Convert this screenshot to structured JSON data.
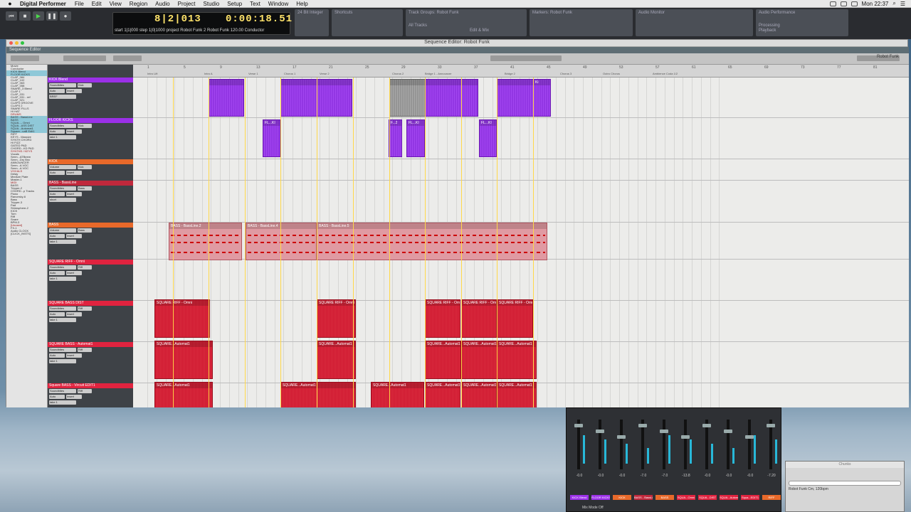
{
  "menubar": {
    "app": "Digital Performer",
    "items": [
      "File",
      "Edit",
      "View",
      "Region",
      "Audio",
      "Project",
      "Studio",
      "Setup",
      "Text",
      "Window",
      "Help"
    ],
    "clock": "Mon 22:37"
  },
  "toolbar": {
    "counter_bars": "8|2|013",
    "counter_time": "0:00:18.51",
    "counter_line": "start 1|1|000 step 1|0|1000 project Robot Funk 2 Robot Funk 120.00 Conductor",
    "panels": [
      "Shortcuts",
      "Track Groups: Robot Funk",
      "Markers: Robot Funk",
      "Audio Monitor",
      "Audio Performance"
    ],
    "panel_sub": [
      "All Tracks",
      "Edit & Mix",
      "Processing",
      "Playback",
      "24 Bit Integer"
    ]
  },
  "window": {
    "title": "Sequence Editor: Robot Funk",
    "tab": "Sequence Editor",
    "seq": "Robot Funk"
  },
  "tracklist": [
    {
      "t": "Movie"
    },
    {
      "t": "Conductor"
    },
    {
      "t": "KICK Blend",
      "hl": true
    },
    {
      "t": "FLOOR KICKS",
      "hl": true
    },
    {
      "t": "CLAP_084"
    },
    {
      "t": "CLAP_102"
    },
    {
      "t": "CLAP_063"
    },
    {
      "t": "CLAP_058"
    },
    {
      "t": "SNARE_3 Blend"
    },
    {
      "t": "CLAP 1"
    },
    {
      "t": "CLAP_031"
    },
    {
      "t": "CLAP_031 - ref"
    },
    {
      "t": "CLAP_021"
    },
    {
      "t": "CLAPS GROOVE"
    },
    {
      "t": "CLAPS 2"
    },
    {
      "t": "SNARE FILLS"
    },
    {
      "t": "HI HAT"
    },
    {
      "t": "DRUMS",
      "grp": true
    },
    {
      "t": "BASS - BassLine",
      "hl": true
    },
    {
      "t": "BASS",
      "hl": true
    },
    {
      "t": "SQUA...- Omni",
      "hl": true
    },
    {
      "t": "SQUA...ASS DIST",
      "hl": true
    },
    {
      "t": "SQUA...Automat1",
      "hl": true
    },
    {
      "t": "Square...uaB Edit1",
      "hl": true
    },
    {
      "t": "RIFF"
    },
    {
      "t": "KEYS - Massive"
    },
    {
      "t": "SYNTH CHORD"
    },
    {
      "t": "HI FIZZ"
    },
    {
      "t": "GATED PAD"
    },
    {
      "t": "CHORD...KD PAD"
    },
    {
      "t": "SYNTHS / KEYS",
      "grp": true
    },
    {
      "t": "Vocals"
    },
    {
      "t": "Serm...ATBeem"
    },
    {
      "t": "Serm...Dry Bnc"
    },
    {
      "t": "ANNOUNCER"
    },
    {
      "t": "Serm...A VOC"
    },
    {
      "t": "Serm...A VOC"
    },
    {
      "t": "VOCALS",
      "grp": true
    },
    {
      "t": "Delay"
    },
    {
      "t": "Medium Plate"
    },
    {
      "t": "Master-1"
    },
    {
      "t": "MIDI",
      "grp": true
    },
    {
      "t": "BASS"
    },
    {
      "t": "Tripper-2"
    },
    {
      "t": "CHORD...p Tracks"
    },
    {
      "t": "Piano"
    },
    {
      "t": "Rancesky-6"
    },
    {
      "t": "Bass"
    },
    {
      "t": "Tripper-3"
    },
    {
      "t": "Pad"
    },
    {
      "t": "Shimsphere-2"
    },
    {
      "t": "KICK"
    },
    {
      "t": "Tom"
    },
    {
      "t": "Riff"
    },
    {
      "t": "Snare"
    },
    {
      "t": "BPM-3"
    },
    {
      "t": "[Unused]",
      "grp": true
    },
    {
      "t": "FX-1"
    },
    {
      "t": "Audio CLOCK"
    },
    {
      "t": "[CLICK_INSTS]"
    }
  ],
  "tracks": [
    {
      "name": "KICK Blend",
      "color": "#9b30e8",
      "a": "Soundbites",
      "b": "Kick",
      "c": "Auto",
      "d": "Insert",
      "e": "BREF"
    },
    {
      "name": "FLOOR KICKS",
      "color": "#9b30e8",
      "a": "Soundbites",
      "b": "Kick",
      "c": "Auto",
      "d": "Insert",
      "e": "take 1"
    },
    {
      "name": "KICK",
      "color": "#e8692a",
      "a": "Volume",
      "b": "Kick",
      "c": "Auto",
      "d": "Insert",
      "e": "Drums"
    },
    {
      "name": "BASS - BassLine",
      "color": "#c0283c",
      "a": "Soundbites",
      "b": "Bass",
      "c": "Auto",
      "d": "Insert",
      "e": "short"
    },
    {
      "name": "BASS",
      "color": "#e8692a",
      "a": "Volume",
      "b": "Bass",
      "c": "Auto",
      "d": "Insert",
      "e": "take 1"
    },
    {
      "name": "SQUARE RIFF - Omni",
      "color": "#e0233f",
      "a": "Soundbites",
      "b": "Riff",
      "c": "Auto",
      "d": "Insert",
      "e": "take 1"
    },
    {
      "name": "SQUARE BASS DIST",
      "color": "#e0233f",
      "a": "Soundbites",
      "b": "Riff",
      "c": "Auto",
      "d": "Insert",
      "e": "take 1"
    },
    {
      "name": "SQUARE BASS - Automat1",
      "color": "#e0233f",
      "a": "Soundbites",
      "b": "Riff",
      "c": "Auto",
      "d": "Insert",
      "e": "take 1"
    },
    {
      "name": "Square BASS - Vircuit EDIT1",
      "color": "#e0233f",
      "a": "Soundbites",
      "b": "Riff",
      "c": "Auto",
      "d": "Insert",
      "e": "take 1"
    }
  ],
  "ruler": {
    "bars": [
      "1",
      "5",
      "9",
      "13",
      "17",
      "21",
      "25",
      "29",
      "33",
      "37",
      "41",
      "45",
      "49",
      "53",
      "57",
      "61",
      "65",
      "69",
      "73",
      "77",
      "81"
    ],
    "markers": [
      "Intro Lift",
      "Intro A",
      "Verse 1",
      "Chorus 1",
      "Verse 2",
      "Chorus 2",
      "Bridge 1 - Announcer",
      "Bridge 2",
      "Chorus 3",
      "Outro Chorus",
      "Ambience Coda 1/2"
    ]
  },
  "clips": {
    "kick_blend": [
      {
        "label": ""
      },
      {
        "label": ""
      },
      {
        "label": ""
      },
      {
        "label": ""
      },
      {
        "label": ""
      },
      {
        "label": "Ki"
      }
    ],
    "floor_kicks": [
      {
        "label": "FL...KI"
      },
      {
        "label": "F...2"
      },
      {
        "label": "FL...KI"
      },
      {
        "label": "FL...KI"
      }
    ],
    "bass_line": [
      {
        "label": "BASS - BassLine.2"
      },
      {
        "label": "BASS - BassLine.4"
      },
      {
        "label": "BASS - BassLine.5"
      }
    ],
    "square_riff": [
      {
        "label": "SQUARE RIFF - Omni"
      },
      {
        "label": "SQUARE RIFF - Omni"
      },
      {
        "label": "SQUARE RIFF - Omni"
      },
      {
        "label": "SQUARE RIFF - Omni"
      },
      {
        "label": "SQUARE RIFF - Omni"
      }
    ],
    "square_dist": [
      {
        "label": "SQUARE...Automat1"
      },
      {
        "label": "SQUARE...Automat1"
      },
      {
        "label": "SQUARE...Automat1"
      },
      {
        "label": "SQUARE...Automat1"
      },
      {
        "label": "SQUARE...Automat1"
      }
    ],
    "square_auto": [
      {
        "label": "SQUARE...Automat1"
      },
      {
        "label": "SQUARE...Automat1"
      },
      {
        "label": "SQUARE...Automat1"
      },
      {
        "label": "SQUARE...Automat1"
      },
      {
        "label": "SQUARE...Automat1"
      },
      {
        "label": "SQUARE...Automat1"
      }
    ],
    "square_vircuit": [
      {
        "label": "Square B...uaB EDIT1"
      },
      {
        "label": "Square B...uaB EDIT1"
      },
      {
        "label": "Square B...uaB EDIT1"
      },
      {
        "label": "Square B...uaB EDIT1"
      },
      {
        "label": "Square B...uaB EDIT1"
      }
    ]
  },
  "mixer": {
    "strips": [
      {
        "name": "KICK Blend",
        "value": "-0.0",
        "color": "#9b30e8"
      },
      {
        "name": "FLOOR KICKS",
        "value": "-0.0",
        "color": "#9b30e8"
      },
      {
        "name": "KICK",
        "value": "-0.0",
        "color": "#e8692a"
      },
      {
        "name": "BASS - BassLine",
        "value": "-7.0",
        "color": "#c0283c"
      },
      {
        "name": "BASS",
        "value": "-7.0",
        "color": "#e8692a"
      },
      {
        "name": "SQUA...Omni",
        "value": "-13.8",
        "color": "#e0233f"
      },
      {
        "name": "SQUA...DIST",
        "value": "-0.0",
        "color": "#e0233f"
      },
      {
        "name": "SQUA...Automat1",
        "value": "-0.0",
        "color": "#e0233f"
      },
      {
        "name": "Squa...EDIT1",
        "value": "-0.0",
        "color": "#e0233f"
      },
      {
        "name": "RIFF",
        "value": "-7.20",
        "color": "#e8692a"
      }
    ],
    "footer": "Mix Mode Off"
  },
  "chunks": {
    "title": "Chunks",
    "rows": [
      "Robot Funk",
      "Cm, 120bpm"
    ]
  }
}
